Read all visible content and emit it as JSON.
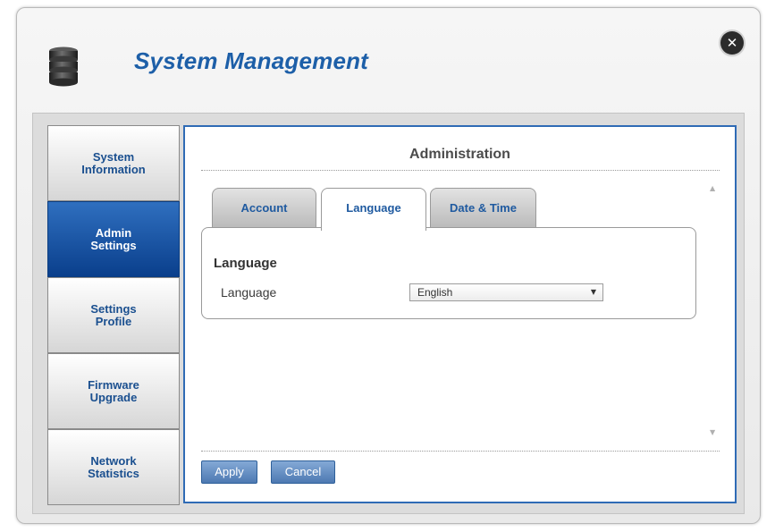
{
  "window": {
    "title": "System Management",
    "close_icon": "close-icon",
    "app_icon": "database-icon"
  },
  "sidebar": {
    "items": [
      {
        "label": "System\nInformation",
        "active": false
      },
      {
        "label": "Admin\nSettings",
        "active": true
      },
      {
        "label": "Settings\nProfile",
        "active": false
      },
      {
        "label": "Firmware\nUpgrade",
        "active": false
      },
      {
        "label": "Network\nStatistics",
        "active": false
      }
    ]
  },
  "main": {
    "section_title": "Administration",
    "tabs": [
      {
        "label": "Account",
        "active": false
      },
      {
        "label": "Language",
        "active": true
      },
      {
        "label": "Date & Time",
        "active": false
      }
    ],
    "language_panel": {
      "heading": "Language",
      "field_label": "Language",
      "selected_value": "English"
    },
    "buttons": {
      "apply": "Apply",
      "cancel": "Cancel"
    }
  },
  "colors": {
    "title_blue": "#1d5fa8",
    "active_nav": "#0a3f8c",
    "content_border": "#2f6bb5",
    "button_blue": "#5f88bf"
  }
}
